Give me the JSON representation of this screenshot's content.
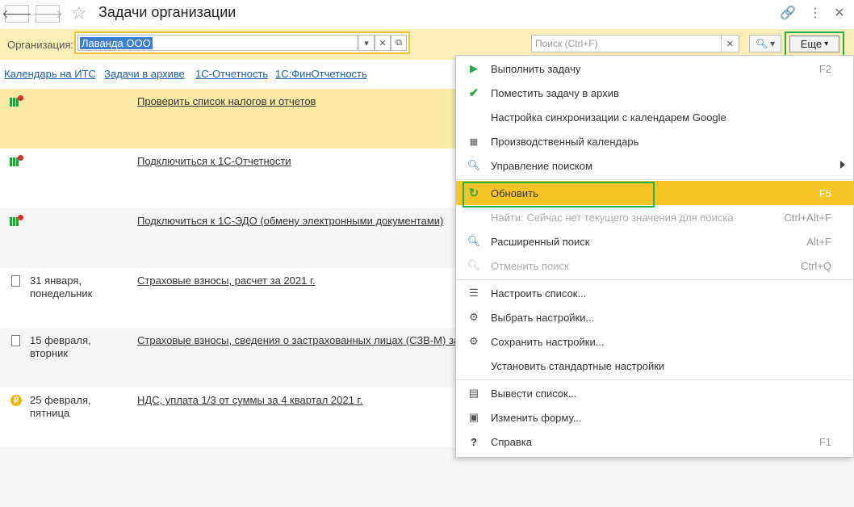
{
  "window": {
    "title": "Задачи организации"
  },
  "toolbar": {
    "back_icon": "arrow-left-icon",
    "forward_icon": "arrow-right-icon",
    "favorite_icon": "star-icon",
    "link_icon": "link-icon",
    "more_icon": "dots-icon",
    "close_icon": "close-icon"
  },
  "filter": {
    "org_label": "Организация:",
    "org_value": "Лаванда ООО",
    "search_placeholder": "Поиск (Ctrl+F)",
    "more_label": "Еще"
  },
  "links": [
    "Календарь на ИТС",
    "Задачи в архиве",
    "1С-Отчетность",
    "1С:ФинОтчетность"
  ],
  "rows": [
    {
      "icon": "task-icon",
      "date1": "",
      "date2": "",
      "title": "Проверить список налогов и отчетов",
      "selected": true
    },
    {
      "icon": "task-icon",
      "date1": "",
      "date2": "",
      "title": "Подключиться к 1С-Отчетности"
    },
    {
      "icon": "task-icon",
      "date1": "",
      "date2": "",
      "title": "Подключиться к 1С-ЭДО (обмену электронными документами)"
    },
    {
      "icon": "document-icon",
      "date1": "31 января,",
      "date2": "понедельник",
      "title": "Страховые взносы, расчет за 2021 г."
    },
    {
      "icon": "document-icon",
      "date1": "15 февраля,",
      "date2": "вторник",
      "title": "Страховые взносы, сведения о застрахованных лицах (СЗВ-М) за"
    },
    {
      "icon": "ruble-coin-icon",
      "date1": "25 февраля,",
      "date2": "пятница",
      "title": "НДС, уплата 1/3 от суммы за 4 квартал 2021 г."
    }
  ],
  "menu": {
    "items": [
      {
        "id": "run-task",
        "icon": "play-icon",
        "label": "Выполнить задачу",
        "shortcut": "F2"
      },
      {
        "id": "archive",
        "icon": "checkmark-icon",
        "label": "Поместить задачу в архив",
        "shortcut": ""
      },
      {
        "id": "google-sync",
        "icon": "",
        "label": "Настройка синхронизации с календарем Google",
        "shortcut": ""
      },
      {
        "id": "prod-calendar",
        "icon": "calendar-icon",
        "label": "Производственный календарь",
        "shortcut": ""
      },
      {
        "id": "search-mgmt",
        "icon": "search-icon",
        "label": "Управление поиском",
        "shortcut": ""
      },
      {
        "id": "refresh",
        "icon": "refresh-icon",
        "label": "Обновить",
        "shortcut": "F5"
      },
      {
        "id": "find",
        "icon": "",
        "label": "Найти: Сейчас нет текущего значения для поиска",
        "shortcut": "Ctrl+Alt+F"
      },
      {
        "id": "adv-search",
        "icon": "search-icon",
        "label": "Расширенный поиск",
        "shortcut": "Alt+F"
      },
      {
        "id": "cancel-search",
        "icon": "search-cancel-icon",
        "label": "Отменить поиск",
        "shortcut": "Ctrl+Q"
      },
      {
        "id": "configure-list",
        "icon": "list-settings-icon",
        "label": "Настроить список...",
        "shortcut": ""
      },
      {
        "id": "choose-settings",
        "icon": "settings-open-icon",
        "label": "Выбрать настройки...",
        "shortcut": ""
      },
      {
        "id": "save-settings",
        "icon": "settings-save-icon",
        "label": "Сохранить настройки...",
        "shortcut": ""
      },
      {
        "id": "default-settings",
        "icon": "",
        "label": "Установить стандартные настройки",
        "shortcut": ""
      },
      {
        "id": "output-list",
        "icon": "printer-icon",
        "label": "Вывести список...",
        "shortcut": ""
      },
      {
        "id": "change-form",
        "icon": "form-icon",
        "label": "Изменить форму...",
        "shortcut": ""
      },
      {
        "id": "help",
        "icon": "help-icon",
        "label": "Справка",
        "shortcut": "F1"
      }
    ]
  }
}
